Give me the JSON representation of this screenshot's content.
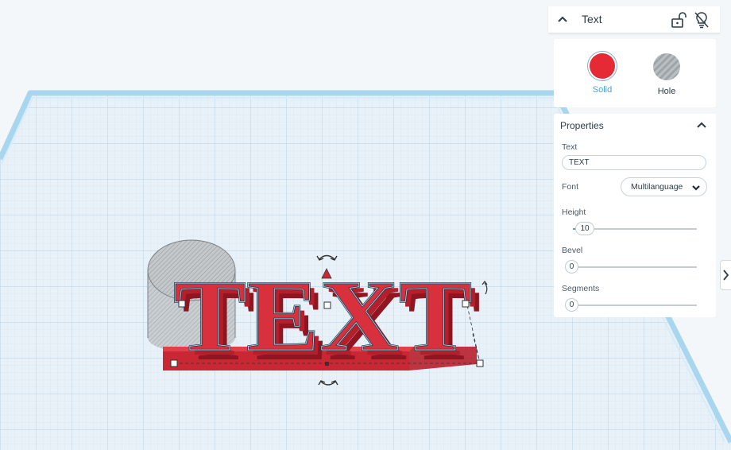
{
  "inspector": {
    "title": "Text",
    "icons": {
      "collapse": "chevron-up-icon",
      "lock": "lock-open-icon",
      "visibility": "bulb-off-icon"
    },
    "materials": {
      "solid": {
        "label": "Solid",
        "color": "#e52a36",
        "selected": true
      },
      "hole": {
        "label": "Hole",
        "selected": false
      }
    },
    "properties": {
      "title": "Properties",
      "text_label": "Text",
      "text_value": "TEXT",
      "font_label": "Font",
      "font_value": "Multilanguage",
      "height_label": "Height",
      "height_value": "10",
      "bevel_label": "Bevel",
      "bevel_value": "0",
      "segments_label": "Segments",
      "segments_value": "0"
    }
  },
  "workplane": {
    "shape_text": "TEXT",
    "shape_color": "#d8303c",
    "hole_shape": "cylinder"
  },
  "colors": {
    "accent": "#4f9fd2",
    "solid_red": "#e52a36",
    "grid": "#cfe3f1",
    "workplane": "#e7f0f7"
  }
}
